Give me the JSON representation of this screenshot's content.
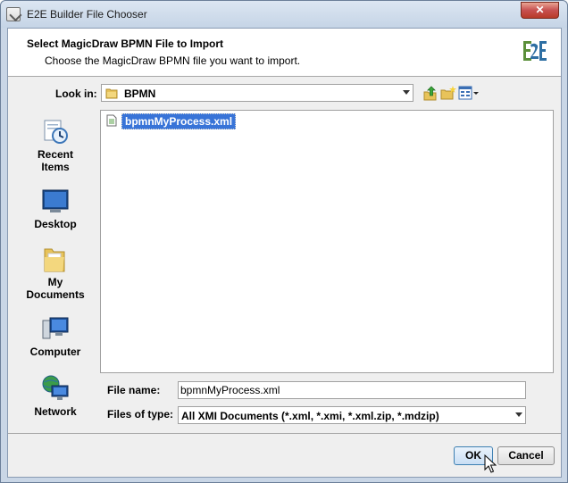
{
  "window": {
    "title": "E2E Builder File Chooser",
    "close_label": "✕"
  },
  "header": {
    "title": "Select MagicDraw BPMN File to Import",
    "subtitle": "Choose the MagicDraw BPMN file you want to import."
  },
  "look_in": {
    "label": "Look in:",
    "value": "BPMN"
  },
  "places": [
    {
      "label_line1": "Recent",
      "label_line2": "Items",
      "icon": "recent-items-icon"
    },
    {
      "label_line1": "Desktop",
      "label_line2": "",
      "icon": "desktop-icon"
    },
    {
      "label_line1": "My",
      "label_line2": "Documents",
      "icon": "my-documents-icon"
    },
    {
      "label_line1": "Computer",
      "label_line2": "",
      "icon": "computer-icon"
    },
    {
      "label_line1": "Network",
      "label_line2": "",
      "icon": "network-icon"
    }
  ],
  "files": [
    {
      "name": "bpmnMyProcess.xml",
      "selected": true
    }
  ],
  "file_name": {
    "label": "File name:",
    "value": "bpmnMyProcess.xml"
  },
  "file_type": {
    "label": "Files of type:",
    "value": "All XMI Documents (*.xml, *.xmi, *.xml.zip, *.mdzip)"
  },
  "buttons": {
    "ok_label": "OK",
    "cancel_label": "Cancel"
  },
  "colors": {
    "selection": "#3874d8",
    "window_frame": "#c9d6e6",
    "close_button": "#c75050"
  }
}
